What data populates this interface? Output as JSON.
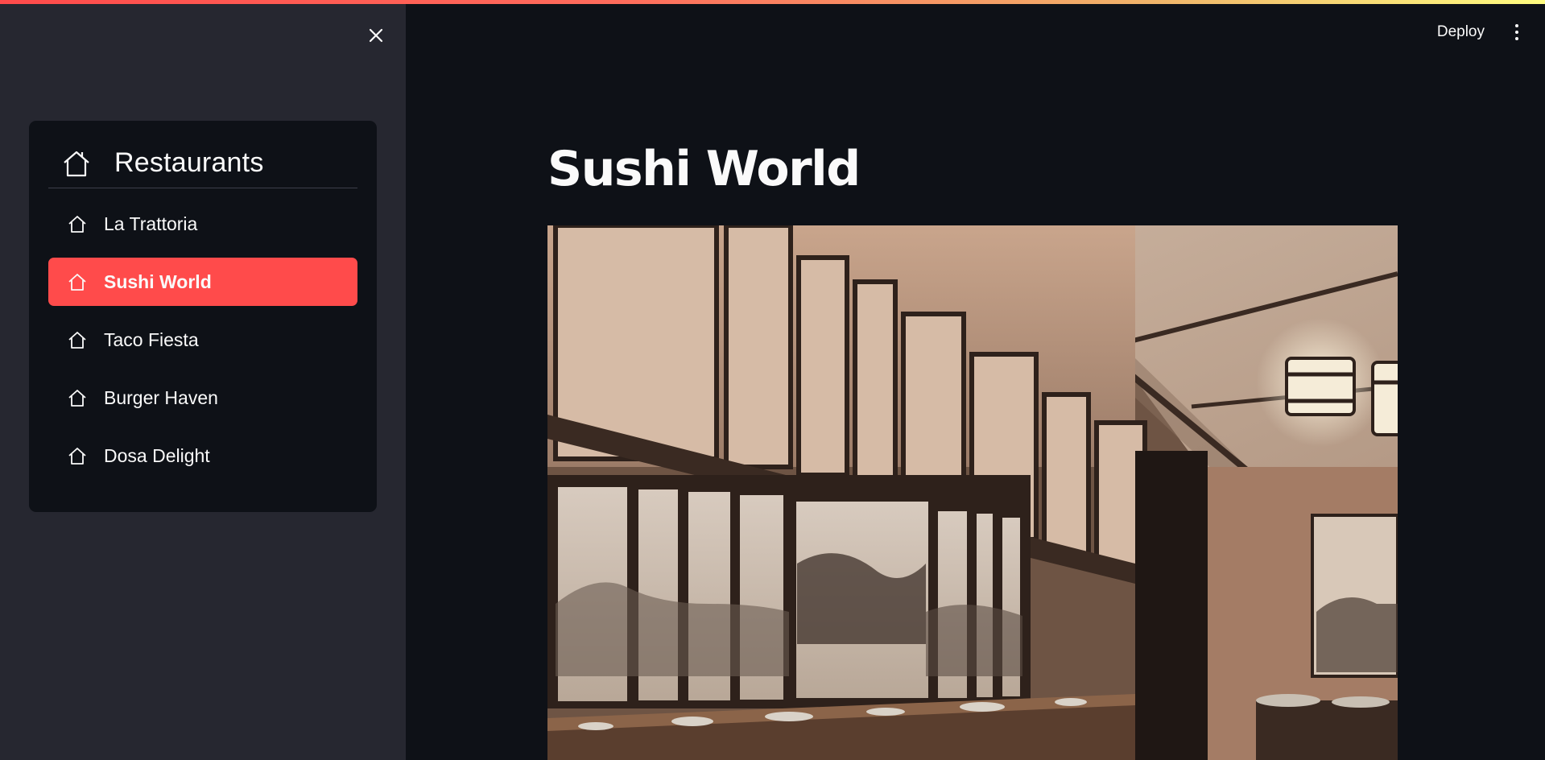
{
  "window": {
    "accent_gradient": [
      "#ff4b4b",
      "#fffd80"
    ],
    "background": "#0e1117",
    "sidebar_background": "#262730"
  },
  "sidebar": {
    "close_icon": "close-icon",
    "menu": {
      "title": "Restaurants",
      "title_icon": "house-icon",
      "items": [
        {
          "label": "La Trattoria",
          "icon": "house-icon",
          "active": false
        },
        {
          "label": "Sushi World",
          "icon": "house-icon",
          "active": true
        },
        {
          "label": "Taco Fiesta",
          "icon": "house-icon",
          "active": false
        },
        {
          "label": "Burger Haven",
          "icon": "house-icon",
          "active": false
        },
        {
          "label": "Dosa Delight",
          "icon": "house-icon",
          "active": false
        }
      ],
      "active_color": "#ff4b4b"
    }
  },
  "header": {
    "deploy_label": "Deploy",
    "menu_icon": "kebab-menu-icon"
  },
  "main": {
    "title": "Sushi World",
    "hero_image": "sushi-restaurant-interior"
  }
}
